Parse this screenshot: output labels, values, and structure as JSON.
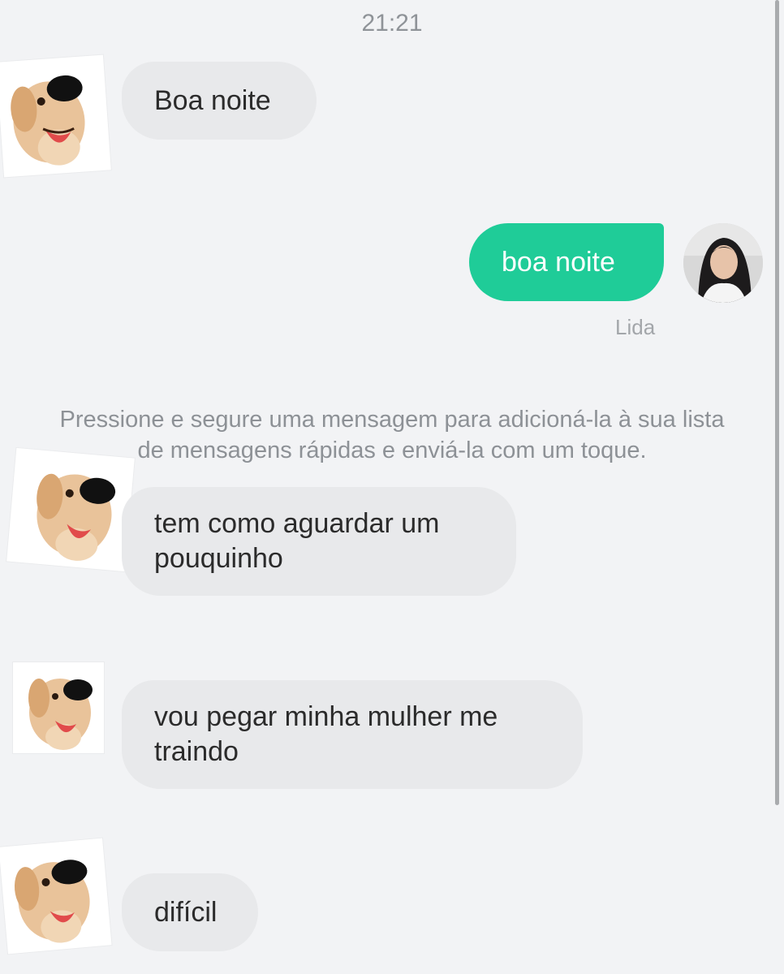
{
  "chat": {
    "timestamp": "21:21",
    "hint": "Pressione e segure uma mensagem para adicioná-la à sua lista\nde mensagens rápidas e enviá-la com um toque.",
    "messages": [
      {
        "direction": "in",
        "text": "Boa noite"
      },
      {
        "direction": "out",
        "text": "boa noite",
        "status": "Lida"
      },
      {
        "direction": "in",
        "text": "tem como aguardar um\npouquinho"
      },
      {
        "direction": "in",
        "text": "vou pegar minha mulher me\ntraindo"
      },
      {
        "direction": "in",
        "text": "difícil"
      }
    ]
  },
  "colors": {
    "background": "#f2f3f5",
    "incoming_bubble": "#e8e9eb",
    "outgoing_bubble": "#1fcc98",
    "muted_text": "#8f9398"
  },
  "icons": {
    "contact_avatar": "puppy-sticker-avatar",
    "user_avatar": "user-photo-avatar"
  }
}
